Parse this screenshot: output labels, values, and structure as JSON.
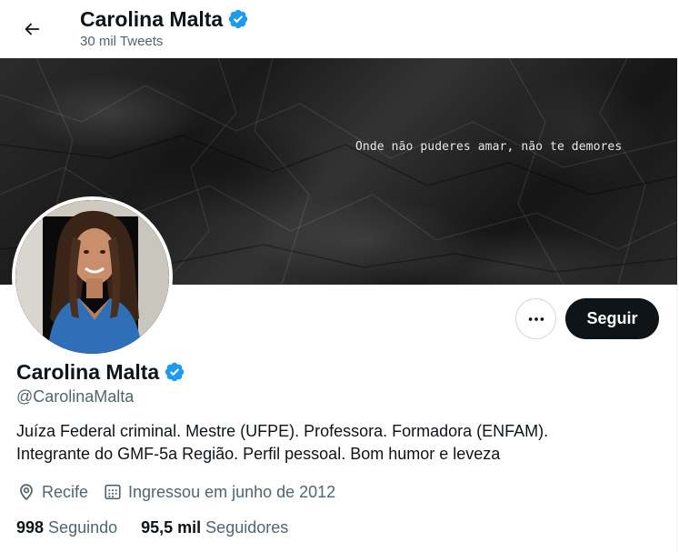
{
  "header": {
    "name": "Carolina Malta",
    "tweets_count": "30 mil Tweets",
    "back_icon": "arrow-left-icon"
  },
  "banner": {
    "quote": "Onde não puderes amar, não te demores"
  },
  "actions": {
    "more_icon": "ellipsis-icon",
    "follow_label": "Seguir"
  },
  "profile": {
    "name": "Carolina Malta",
    "verified": true,
    "handle": "@CarolinaMalta",
    "bio_lines": [
      "Juíza Federal criminal. Mestre (UFPE). Professora. Formadora (ENFAM).",
      "Integrante do GMF-5a Região. Perfil pessoal. Bom humor e leveza"
    ],
    "location": "Recife",
    "joined": "Ingressou em junho de 2012",
    "following_count": "998",
    "following_label": "Seguindo",
    "followers_count": "95,5 mil",
    "followers_label": "Seguidores"
  },
  "colors": {
    "verified_blue": "#1d9bf0",
    "text_primary": "#0f1419",
    "text_secondary": "#536471",
    "follow_bg": "#0f1419"
  }
}
